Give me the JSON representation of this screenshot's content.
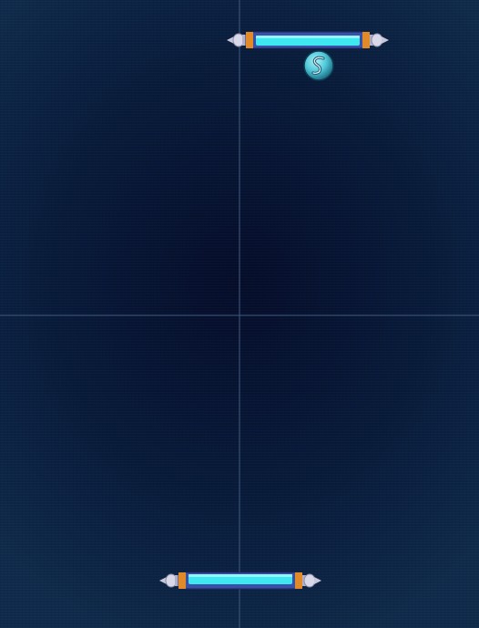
{
  "game": {
    "type": "air-hockey",
    "background_color": "#081a3a",
    "grid_line_color": "#3c5578",
    "paddle_colors": {
      "bar": "#3ee8f0",
      "frame": "#3a4fa8",
      "accent": "#e08a2a",
      "cap": "#d8d8e8"
    },
    "puck": {
      "icon": "s-logo-icon",
      "color": "#4fc8d8"
    }
  }
}
